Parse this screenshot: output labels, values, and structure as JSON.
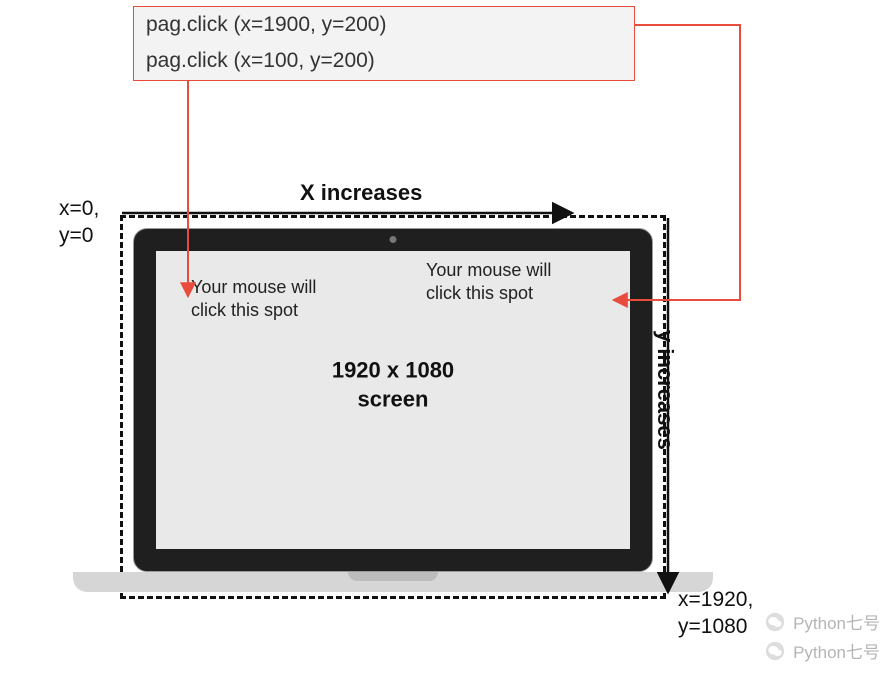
{
  "callouts": {
    "code1": "pag.click (x=1900, y=200)",
    "code2": "pag.click (x=100, y=200)"
  },
  "labels": {
    "origin_x": "x=0,",
    "origin_y": "y=0",
    "end_x": "x=1920,",
    "end_y": "y=1080",
    "x_increases": "X increases",
    "y_increases": "y increases"
  },
  "screen": {
    "resolution_line1": "1920 x 1080",
    "resolution_line2": "screen",
    "hint_left_line1": "Your mouse will",
    "hint_left_line2": "click this spot",
    "hint_right_line1": "Your mouse will",
    "hint_right_line2": "click this spot"
  },
  "watermarks": {
    "line1": "Python七号",
    "line2": "Python七号"
  }
}
